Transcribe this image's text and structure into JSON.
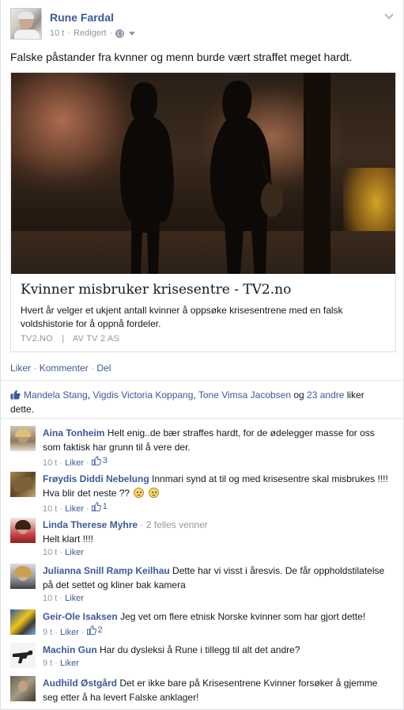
{
  "post": {
    "author": "Rune Fardal",
    "time": "10 t",
    "edited": "Redigert",
    "text": "Falske påstander fra kvnner og menn burde vært straffet meget hardt.",
    "share": {
      "title": "Kvinner misbruker krisesentre - TV2.no",
      "description": "Hvert år velger et ukjent antall kvinner å oppsøke krisesentrene med en falsk voldshistorie for å oppnå fordeler.",
      "source": "TV2.NO",
      "separator": "|",
      "by": "AV TV 2 AS"
    },
    "actions": {
      "like": "Liker",
      "comment": "Kommenter",
      "share": "Del"
    },
    "likes": {
      "names": [
        "Mandela Stang",
        "Vigdis Victoria Koppang",
        "Tone Vimsa Jacobsen"
      ],
      "sep1": ", ",
      "sep2": ", ",
      "and": " og ",
      "others": "23 andre",
      "suffix": " liker dette."
    }
  },
  "comments": [
    {
      "name": "Aina Tonheim",
      "text": "Helt enig..de bær straffes hardt, for de ødelegger masse for oss som faktisk har grunn til å vere der.",
      "time": "10 t",
      "like_label": "Liker",
      "likes": "3"
    },
    {
      "name": "Frøydis Diddi Nebelung",
      "text": "Innmari synd at til og med krisesentre skal misbrukes !!!! Hva blir det neste ??",
      "time": "10 t",
      "like_label": "Liker",
      "likes": "1"
    },
    {
      "name": "Linda Therese Myhre",
      "mutual": "· 2 felles venner",
      "text": "Helt klart !!!!",
      "time": "10 t",
      "like_label": "Liker"
    },
    {
      "name": "Julianna Snill Ramp Keilhau",
      "text": "Dette har vi visst i åresvis. De får oppholdstilatelse på det settet og kliner bak kamera",
      "time": "10 t",
      "like_label": "Liker"
    },
    {
      "name": "Geir-Ole Isaksen",
      "text": "Jeg vet om flere etnisk Norske kvinner som har gjort dette!",
      "time": "9 t",
      "like_label": "Liker",
      "likes": "2"
    },
    {
      "name": "Machin Gun",
      "text": "Har du dysleksi å Rune i tillegg til alt det andre?",
      "time": "9 t",
      "like_label": "Liker"
    },
    {
      "name": "Audhild Østgård",
      "text": "Det er ikke bare på Krisesentrene Kvinner forsøker å gjemme seg etter å ha levert Falske anklager!"
    }
  ],
  "colors": {
    "link": "#3b5998",
    "meta": "#9197a3",
    "text": "#141823"
  }
}
